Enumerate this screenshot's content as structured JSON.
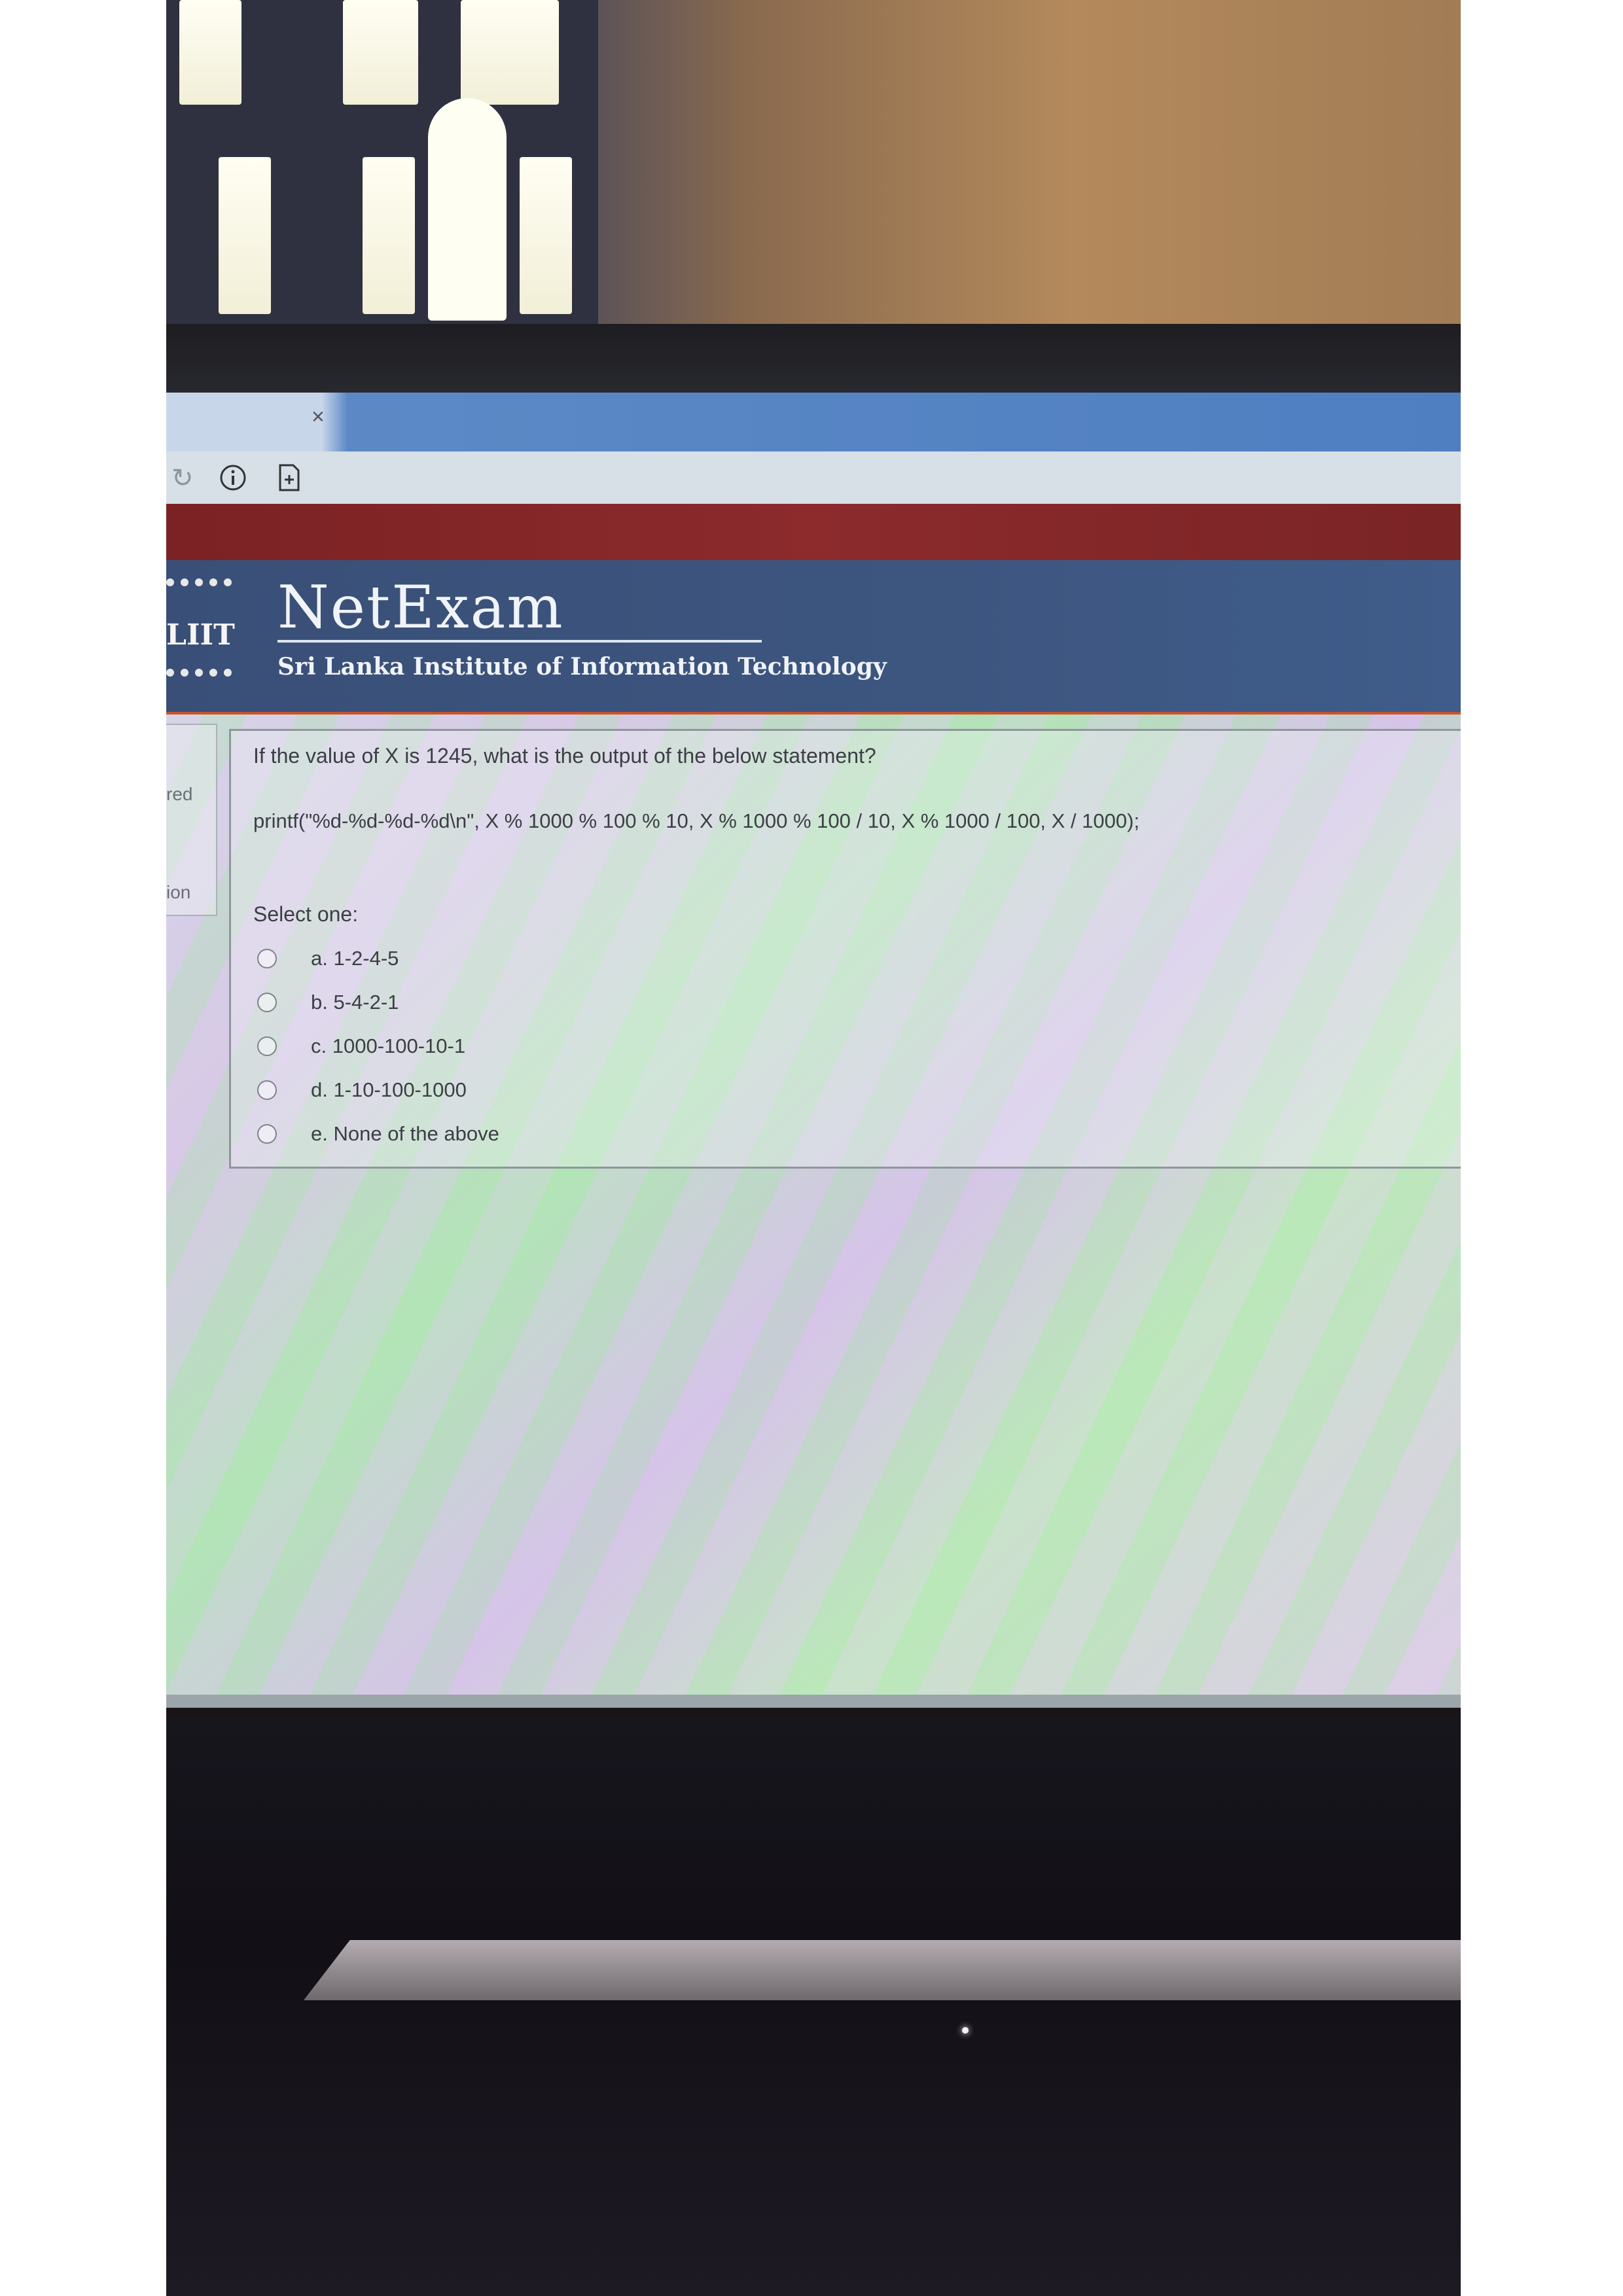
{
  "browser": {
    "tab_close_glyph": "×",
    "toolbar_icons": [
      "reload-icon",
      "info-icon",
      "page-icon"
    ]
  },
  "header": {
    "logo_text": "LIIT",
    "brand": "NetExam",
    "subtitle": "Sri Lanka Institute of Information Technology"
  },
  "sidebar": {
    "items": [
      "red",
      "ion"
    ]
  },
  "question": {
    "text": "If the value of X is 1245, what is the output of the below statement?",
    "code": "printf(\"%d-%d-%d-%d\\n\", X % 1000 % 100 % 10, X % 1000 % 100 / 10, X % 1000 / 100, X / 1000);",
    "select_label": "Select one:",
    "options": [
      "a. 1-2-4-5",
      "b. 5-4-2-1",
      "c. 1000-100-10-1",
      "d. 1-10-100-1000",
      "e. None of the above"
    ]
  },
  "colors": {
    "header_bg": "#3d5680",
    "accent_red": "#8c2a2c",
    "tab_bar": "#4f7fc1"
  }
}
